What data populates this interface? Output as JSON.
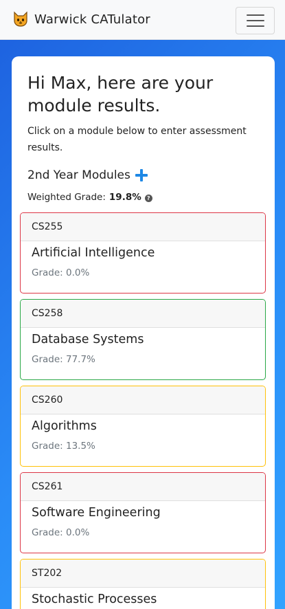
{
  "navbar": {
    "brand_title": "Warwick CATulator",
    "brand_icon": "cat-face-icon",
    "menu_icon": "hamburger-menu-icon"
  },
  "greeting": {
    "heading": "Hi Max, here are your module results.",
    "instructions": "Click on a module below to enter assessment results."
  },
  "year": {
    "label": "2nd Year Modules",
    "add_icon": "plus-icon",
    "weighted_label": "Weighted Grade:",
    "weighted_value": "19.8%",
    "help_icon": "question-circle-icon"
  },
  "modules": [
    {
      "code": "CS255",
      "name": "Artificial Intelligence",
      "grade": "Grade: 0.0%",
      "status_color": "#dc3545"
    },
    {
      "code": "CS258",
      "name": "Database Systems",
      "grade": "Grade: 77.7%",
      "status_color": "#28a745"
    },
    {
      "code": "CS260",
      "name": "Algorithms",
      "grade": "Grade: 13.5%",
      "status_color": "#ffc107"
    },
    {
      "code": "CS261",
      "name": "Software Engineering",
      "grade": "Grade: 0.0%",
      "status_color": "#dc3545"
    },
    {
      "code": "ST202",
      "name": "Stochastic Processes",
      "grade": "",
      "status_color": "#ffc107"
    }
  ],
  "colors": {
    "accent": "#1e88e5",
    "background_gradient_start": "#1e63e0",
    "background_gradient_end": "#32a3ff"
  }
}
